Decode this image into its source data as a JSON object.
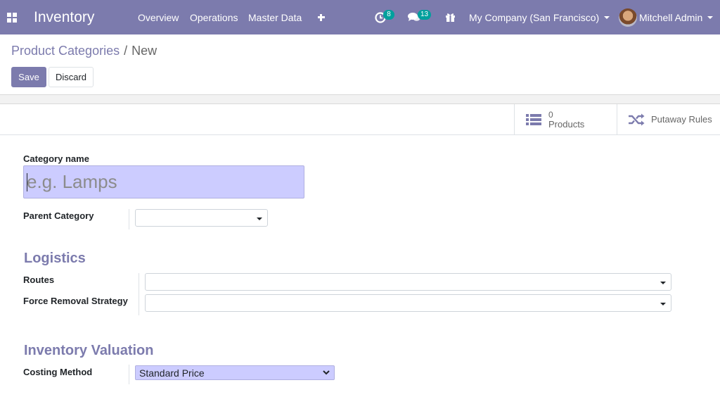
{
  "navbar": {
    "app_name": "Inventory",
    "menu": [
      "Overview",
      "Operations",
      "Master Data"
    ],
    "activity_count": "8",
    "message_count": "13",
    "company": "My Company (San Francisco)",
    "user": "Mitchell Admin"
  },
  "breadcrumb": {
    "parent": "Product Categories",
    "separator": "/",
    "current": "New"
  },
  "buttons": {
    "save": "Save",
    "discard": "Discard"
  },
  "stat_buttons": {
    "products_count": "0",
    "products_label": "Products",
    "putaway_label": "Putaway Rules"
  },
  "form": {
    "category_name_label": "Category name",
    "category_name_placeholder": "e.g. Lamps",
    "parent_category_label": "Parent Category",
    "logistics_title": "Logistics",
    "routes_label": "Routes",
    "force_removal_label": "Force Removal Strategy",
    "valuation_title": "Inventory Valuation",
    "costing_method_label": "Costing Method",
    "costing_method_value": "Standard Price"
  },
  "colors": {
    "brand": "#7c7bad",
    "badge": "#00a09d",
    "input_highlight": "#ccccff"
  },
  "icons": {
    "apps": "apps-grid-icon",
    "create": "plus-icon",
    "activity": "clock-icon",
    "messages": "chat-bubbles-icon",
    "gift": "gift-icon",
    "products": "list-icon",
    "putaway": "shuffle-icon"
  }
}
